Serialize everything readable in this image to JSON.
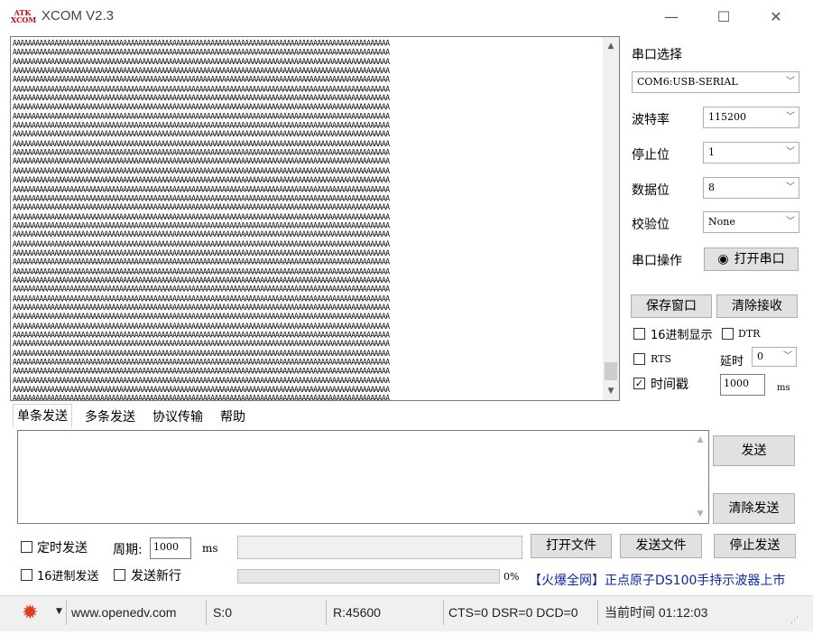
{
  "window": {
    "logo_text": "ATK\nXCOM",
    "title": "XCOM V2.3",
    "minimize": "—",
    "maximize": "☐",
    "close": "✕"
  },
  "receive": {
    "line": "AAAAAAAAAAAAAAAAAAAAAAAAAAAAAAAAAAAAAAAAAAAAAAAAAAAAAAAAAAAAAAAAAAAAAAAAAAAAAAAAAAAAAAAAAAAAAAAAAAA",
    "last_line": "AAAAAAAAAAAAAAAAAAAAAAAAAAAAAAAAAAAAAAAAAAAAAAAAAAAAAAAAAAAAAAAAAAAAAAAAAAAAAAAAAAAAAAAAAAAAAA",
    "line_count": 42
  },
  "serial": {
    "port_label": "串口选择",
    "port_value": "COM6:USB-SERIAL",
    "baud_label": "波特率",
    "baud_value": "115200",
    "stop_label": "停止位",
    "stop_value": "1",
    "data_label": "数据位",
    "data_value": "8",
    "parity_label": "校验位",
    "parity_value": "None",
    "op_label": "串口操作",
    "open_button": "打开串口",
    "save_window": "保存窗口",
    "clear_receive": "清除接收",
    "hex_display": "16进制显示",
    "dtr": "DTR",
    "rts": "RTS",
    "delay_label": "延时",
    "delay_value": "0",
    "timestamp": "时间戳",
    "timestamp_value": "1000",
    "ms": "ms"
  },
  "tabs": [
    "单条发送",
    "多条发送",
    "协议传输",
    "帮助"
  ],
  "send": {
    "send_button": "发送",
    "clear_send": "清除发送",
    "timed_send": "定时发送",
    "period_label": "周期:",
    "period_value": "1000",
    "ms": "ms",
    "open_file": "打开文件",
    "send_file": "发送文件",
    "stop_send": "停止发送",
    "hex_send": "16进制发送",
    "send_newline": "发送新行",
    "progress": "0%",
    "ad_link": "【火爆全网】正点原子DS100手持示波器上市"
  },
  "status": {
    "url": "www.openedv.com",
    "sent": "S:0",
    "received": "R:45600",
    "lines": "CTS=0 DSR=0 DCD=0",
    "time": "当前时间 01:12:03"
  }
}
